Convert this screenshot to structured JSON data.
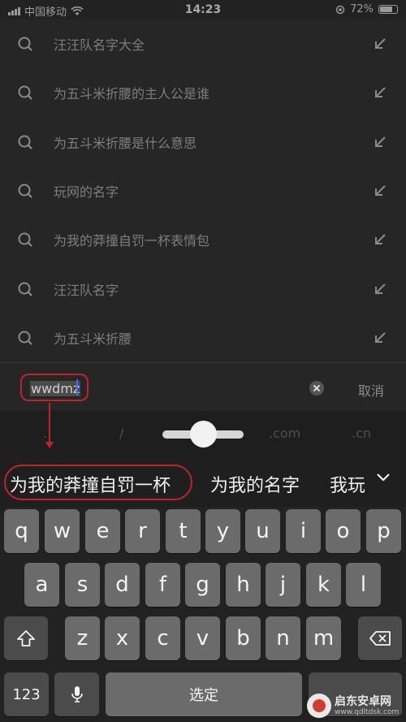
{
  "status_bar": {
    "carrier": "中国移动",
    "time": "14:23",
    "battery": "72%"
  },
  "suggestions": [
    {
      "label": "汪汪队名字大全"
    },
    {
      "label": "为五斗米折腰的主人公是谁"
    },
    {
      "label": "为五斗米折腰是什么意思"
    },
    {
      "label": "玩网的名字"
    },
    {
      "label": "为我的莽撞自罚一杯表情包"
    },
    {
      "label": "汪汪队名字"
    },
    {
      "label": "为五斗米折腰"
    }
  ],
  "search": {
    "query": "wwdmz",
    "cancel_label": "取消"
  },
  "quick_keys": {
    "dot": ".",
    "slash": "/",
    "com": ".com",
    "cn": ".cn"
  },
  "candidates": [
    "为我的莽撞自罚一杯",
    "为我的名字",
    "我玩"
  ],
  "keyboard": {
    "row1": [
      "q",
      "w",
      "e",
      "r",
      "t",
      "y",
      "u",
      "i",
      "o",
      "p"
    ],
    "row2": [
      "a",
      "s",
      "d",
      "f",
      "g",
      "h",
      "j",
      "k",
      "l"
    ],
    "row3": [
      "z",
      "x",
      "c",
      "v",
      "b",
      "n",
      "m"
    ],
    "numbers_label": "123",
    "space_label": "选定"
  },
  "watermark": {
    "text": "启东安卓网",
    "url": "www.qdltdsk.com"
  },
  "colors": {
    "annotation_red": "#c1232b",
    "caret_blue": "#3c6dff"
  }
}
